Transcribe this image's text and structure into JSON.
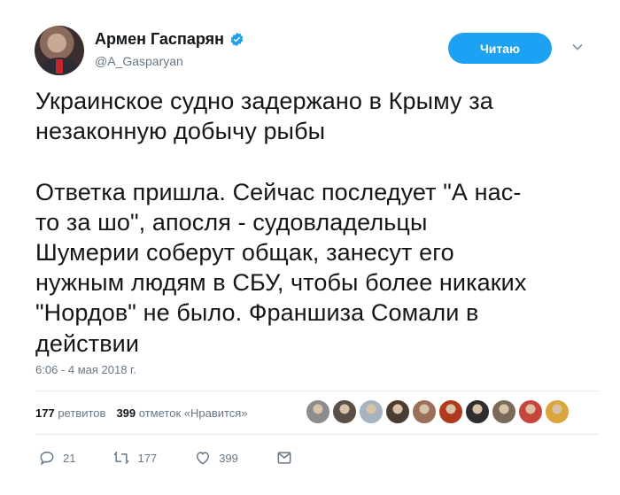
{
  "author": {
    "display_name": "Армен Гаспарян",
    "handle": "@A_Gasparyan",
    "verified": true
  },
  "follow_button": {
    "label": "Читаю"
  },
  "tweet": {
    "text": "Украинское судно задержано в Крыму за\nнезаконную добычу рыбы\n\nОтветка пришла. Сейчас последует \"А нас-\nто за шо\", апосля - судовладельцы\nШумерии соберут общак, занесут его\nнужным людям в СБУ, чтобы более никаких\n\"Нордов\" не было. Франшиза Сомали в\nдействии",
    "timestamp": "6:06 - 4 мая 2018 г."
  },
  "stats": {
    "retweets_count": "177",
    "retweets_label": "ретвитов",
    "likes_count": "399",
    "likes_label": "отметок «Нравится»"
  },
  "liker_avatars": [
    {
      "color": "#8c8c8c"
    },
    {
      "color": "#5a5048"
    },
    {
      "color": "#a7b4bf"
    },
    {
      "color": "#4a3c30"
    },
    {
      "color": "#9a7058"
    },
    {
      "color": "#b03a20"
    },
    {
      "color": "#2e2e2e"
    },
    {
      "color": "#7a6a5a"
    },
    {
      "color": "#c7463c"
    },
    {
      "color": "#d8a63a"
    }
  ],
  "actions": {
    "reply_count": "21",
    "retweet_count": "177",
    "like_count": "399"
  },
  "colors": {
    "accent": "#1da1f2",
    "text": "#14171a",
    "muted": "#657786"
  }
}
